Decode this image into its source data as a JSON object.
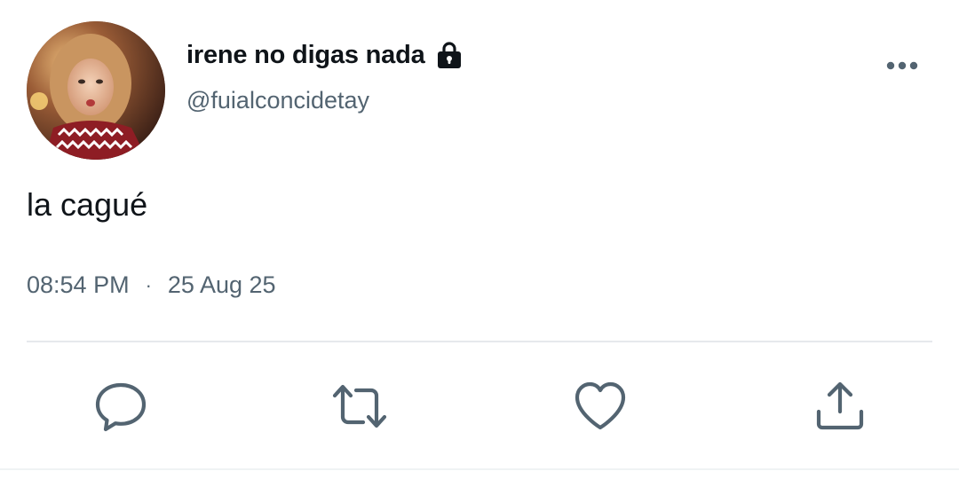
{
  "tweet": {
    "display_name": "irene no digas nada",
    "handle": "@fuialconcidetay",
    "text": "la cagué",
    "time": "08:54 PM",
    "separator": "·",
    "date": "25 Aug 25"
  },
  "icons": {
    "lock": "lock-icon",
    "more": "more-horizontal-icon",
    "reply": "reply-bubble-icon",
    "retweet": "retweet-icon",
    "like": "heart-icon",
    "share": "share-upload-icon"
  },
  "colors": {
    "text_primary": "#0f1419",
    "text_secondary": "#536471",
    "icon_gray": "#536471",
    "divider": "#e6e9ec"
  }
}
